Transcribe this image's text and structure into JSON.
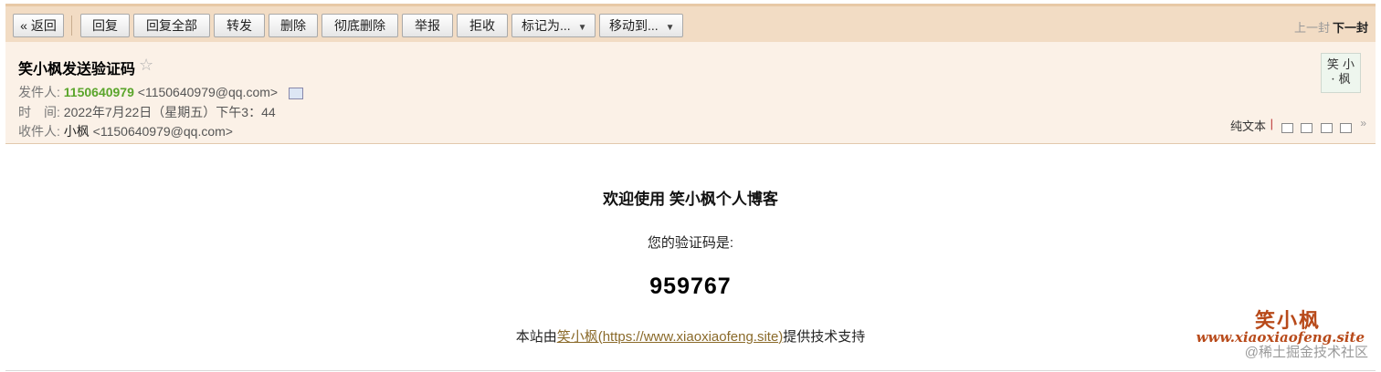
{
  "toolbar": {
    "back": "« 返回",
    "reply": "回复",
    "reply_all": "回复全部",
    "forward": "转发",
    "delete": "删除",
    "delete_permanent": "彻底删除",
    "report": "举报",
    "reject": "拒收",
    "mark_as": "标记为...",
    "move_to": "移动到...",
    "prev": "上一封",
    "next": "下一封"
  },
  "header": {
    "subject": "笑小枫发送验证码",
    "star_icon": "☆",
    "from_label": "发件人:",
    "from_name": "1150640979",
    "from_email": "<1150640979@qq.com>",
    "time_label": "时　间:",
    "time_value": "2022年7月22日（星期五）下午3：44",
    "to_label": "收件人:",
    "to_name": "小枫",
    "to_email": "<1150640979@qq.com>",
    "avatar_line1": "笑 小",
    "avatar_line2": "· 枫",
    "plain_text": "纯文本",
    "divider": "|",
    "expand": "»"
  },
  "body": {
    "welcome": "欢迎使用 笑小枫个人博客",
    "prompt": "您的验证码是:",
    "code": "959767",
    "footer_prefix": "本站由",
    "footer_link": "笑小枫(https://www.xiaoxiaofeng.site)",
    "footer_suffix": "提供技术支持"
  },
  "watermark": {
    "title": "笑小枫",
    "url": "www.xiaoxiaofeng.site",
    "juejin": "@稀土掘金技术社区"
  }
}
